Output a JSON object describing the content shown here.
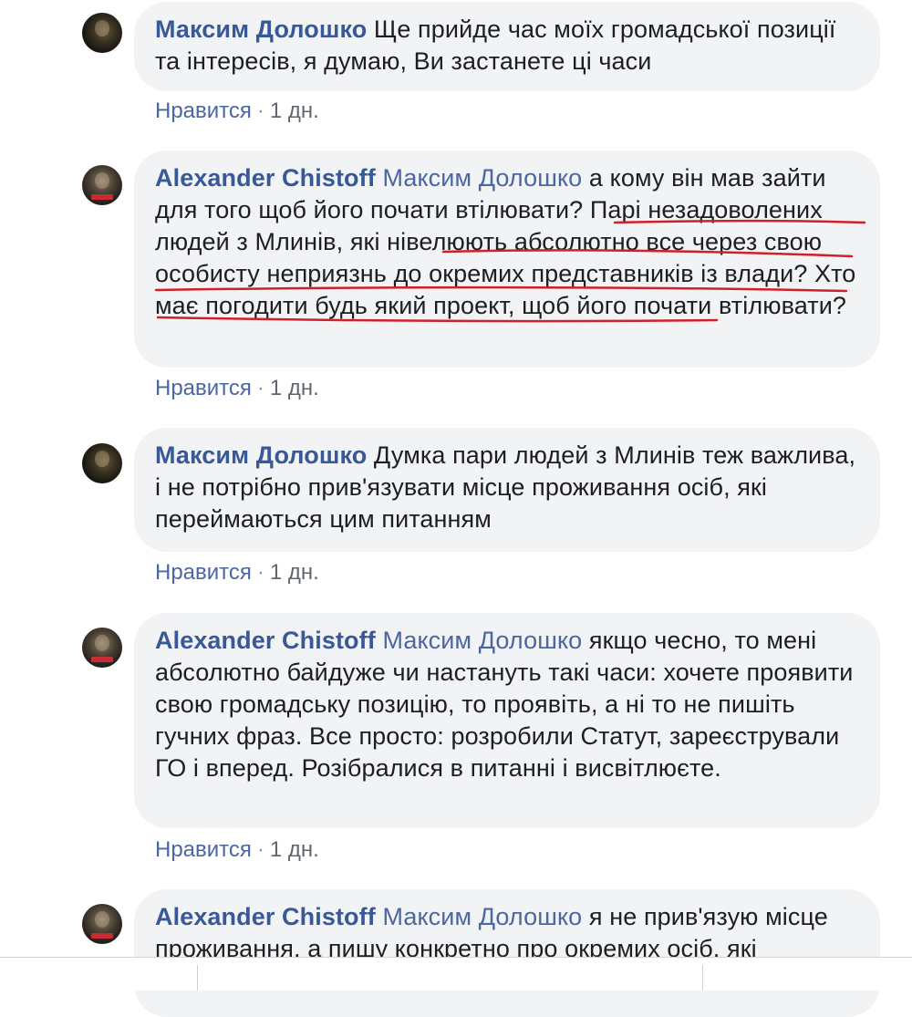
{
  "comments": [
    {
      "author": "Максим Долошко",
      "mention": "",
      "text": " Ще прийде час моїх громадської позиції та інтересів, я думаю, Ви застанете ці часи",
      "like_label": "Нравится",
      "separator": "·",
      "time": "1 дн."
    },
    {
      "author": "Alexander Chistoff",
      "mention": " Максим Долошко",
      "text": " а кому він мав зайти для того щоб його почати втілювати? Парі незадоволених людей з Млинів, які нівелюють абсолютно все через свою особисту неприязнь до окремих представників із влади? Хто має погодити будь який проект, щоб його почати втілювати?",
      "like_label": "Нравится",
      "separator": "·",
      "time": "1 дн."
    },
    {
      "author": "Максим Долошко",
      "mention": "",
      "text": " Думка пари людей з Млинів теж важлива, і не потрібно прив'язувати місце проживання осіб, які переймаються цим питанням",
      "like_label": "Нравится",
      "separator": "·",
      "time": "1 дн."
    },
    {
      "author": "Alexander Chistoff",
      "mention": " Максим Долошко",
      "text": " якщо чесно, то мені абсолютно байдуже чи настануть такі часи: хочете проявити свою громадську позицію, то проявіть, а ні то не пишіть гучних фраз. Все просто: розробили Статут, зареєстрували ГО і вперед. Розібралися в питанні і висвітлюєте.",
      "like_label": "Нравится",
      "separator": "·",
      "time": "1 дн."
    },
    {
      "author": "Alexander Chistoff",
      "mention": " Максим Долошко",
      "text": " я не прив'язую місце проживання, а пишу конкретно про окремих осіб, які"
    }
  ],
  "colors": {
    "author": "#385898",
    "bubble_bg": "#f2f3f5",
    "underline": "#d0202a",
    "link": "#4b67a1"
  }
}
